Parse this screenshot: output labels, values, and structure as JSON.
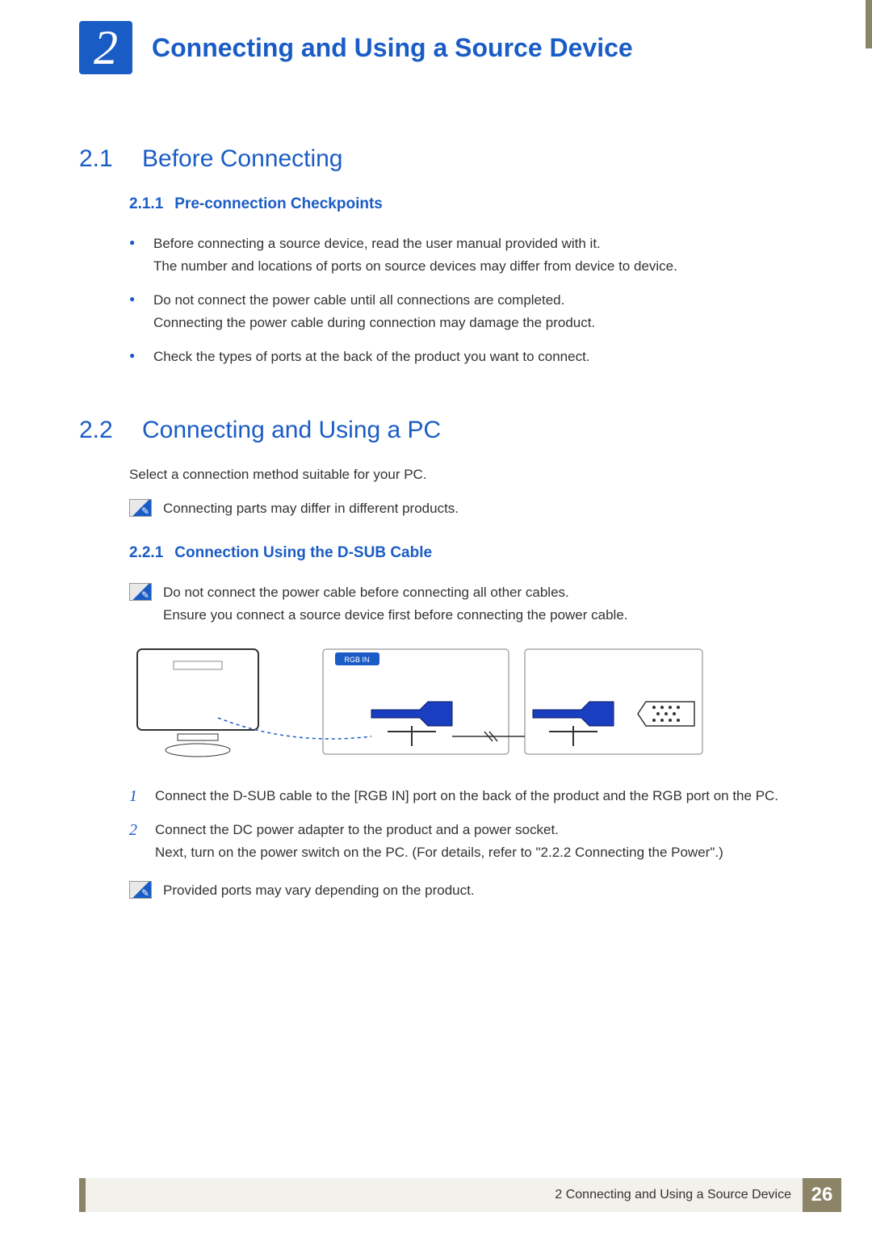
{
  "chapter": {
    "number": "2",
    "title": "Connecting and Using a Source Device"
  },
  "sections": {
    "s1": {
      "num": "2.1",
      "title": "Before Connecting",
      "sub1": {
        "num": "2.1.1",
        "title": "Pre-connection Checkpoints"
      },
      "bullets": {
        "b1a": "Before connecting a source device, read the user manual provided with it.",
        "b1b": "The number and locations of ports on source devices may differ from device to device.",
        "b2a": "Do not connect the power cable until all connections are completed.",
        "b2b": "Connecting the power cable during connection may damage the product.",
        "b3a": "Check the types of ports at the back of the product you want to connect."
      }
    },
    "s2": {
      "num": "2.2",
      "title": "Connecting and Using a PC",
      "intro": "Select a connection method suitable for your PC.",
      "note1": "Connecting parts may differ in different products.",
      "sub1": {
        "num": "2.2.1",
        "title": "Connection Using the D-SUB Cable"
      },
      "note2a": "Do not connect the power cable before connecting all other cables.",
      "note2b": "Ensure you connect a source device first before connecting the power cable.",
      "steps": {
        "n1": "1",
        "t1": "Connect the D-SUB cable to the [RGB IN] port on the back of the product and the RGB port on the PC.",
        "n2": "2",
        "t2a": "Connect the DC power adapter to the product and a power socket.",
        "t2b": "Next, turn on the power switch on the PC. (For details, refer to \"2.2.2    Connecting the Power\".)"
      },
      "note3": "Provided ports may vary depending on the product."
    }
  },
  "diagram": {
    "port_label": "RGB IN"
  },
  "footer": {
    "chapter_label": "2 Connecting and Using a Source Device",
    "page": "26"
  }
}
